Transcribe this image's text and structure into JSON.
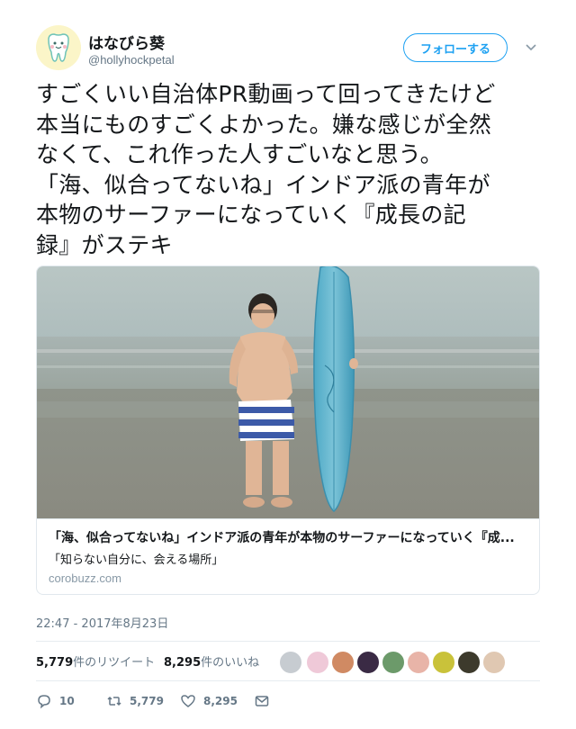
{
  "user": {
    "name": "はなびら葵",
    "handle": "@hollyhockpetal",
    "follow_label": "フォローする"
  },
  "tweet": {
    "lines": [
      "すごくいい自治体PR動画って回ってきたけど",
      "本当にものすごくよかった。嫌な感じが全然",
      "なくて、これ作った人すごいなと思う。",
      "「海、似合ってないね」インドア派の青年が",
      "本物のサーファーになっていく『成長の記",
      "録』がステキ"
    ]
  },
  "card": {
    "title": "「海、似合ってないね」インドア派の青年が本物のサーファーになっていく『成...",
    "description": "「知らない自分に、会える場所」",
    "domain": "corobuzz.com"
  },
  "timestamp": "22:47 - 2017年8月23日",
  "stats": {
    "retweets_count": "5,779",
    "retweets_label": "件のリツイート",
    "likes_count": "8,295",
    "likes_label": "件のいいね"
  },
  "actions": {
    "reply_count": "10",
    "retweet_count": "5,779",
    "like_count": "8,295"
  },
  "colors": {
    "accent": "#1da1f2",
    "secondary_text": "#657786"
  }
}
